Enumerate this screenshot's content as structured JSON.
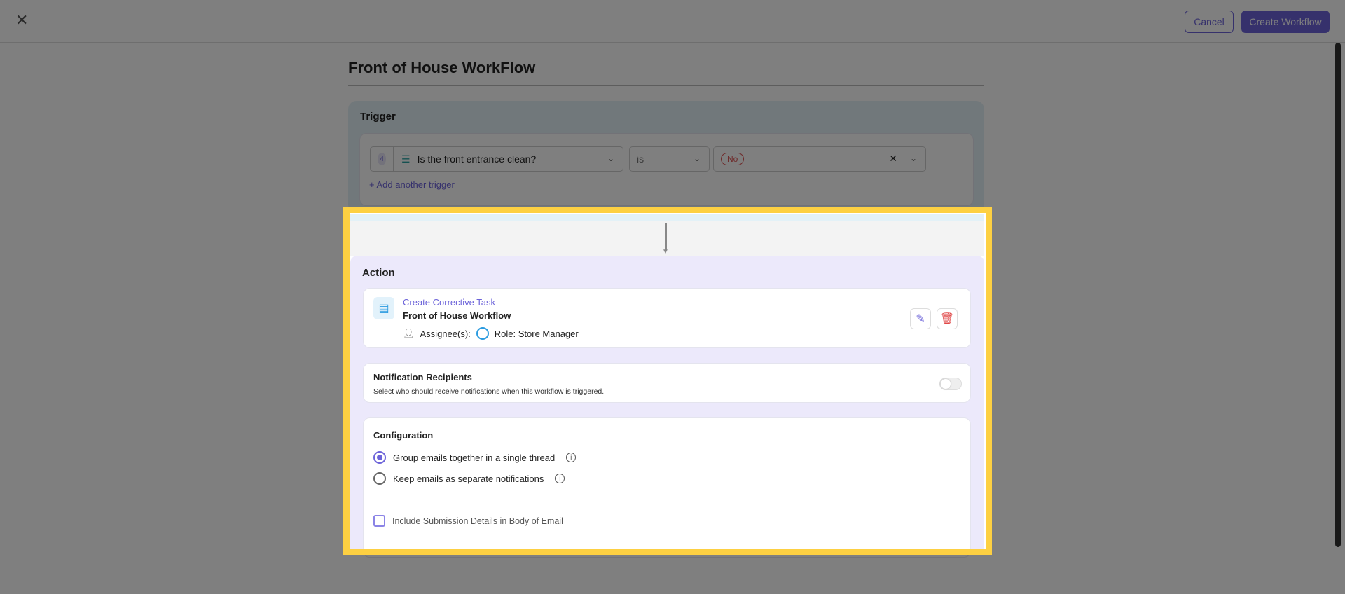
{
  "header": {
    "cancel": "Cancel",
    "create": "Create Workflow"
  },
  "title": "Front of House WorkFlow",
  "trigger": {
    "label": "Trigger",
    "number": "4",
    "question": "Is the front entrance clean?",
    "operator": "is",
    "value": "No",
    "add": "Add another trigger"
  },
  "action": {
    "label": "Action",
    "task_type": "Create Corrective Task",
    "task_name": "Front of House Workflow",
    "assignee_label": "Assignee(s):",
    "assignee_value": "Role: Store Manager"
  },
  "notifications": {
    "title": "Notification Recipients",
    "desc": "Select who should receive notifications when this workflow is triggered.",
    "enabled": false
  },
  "configuration": {
    "title": "Configuration",
    "option1": "Group emails together in a single thread",
    "option2": "Keep emails as separate notifications",
    "selected": "option1",
    "checkbox": "Include Submission Details in Body of Email",
    "checked": false
  }
}
